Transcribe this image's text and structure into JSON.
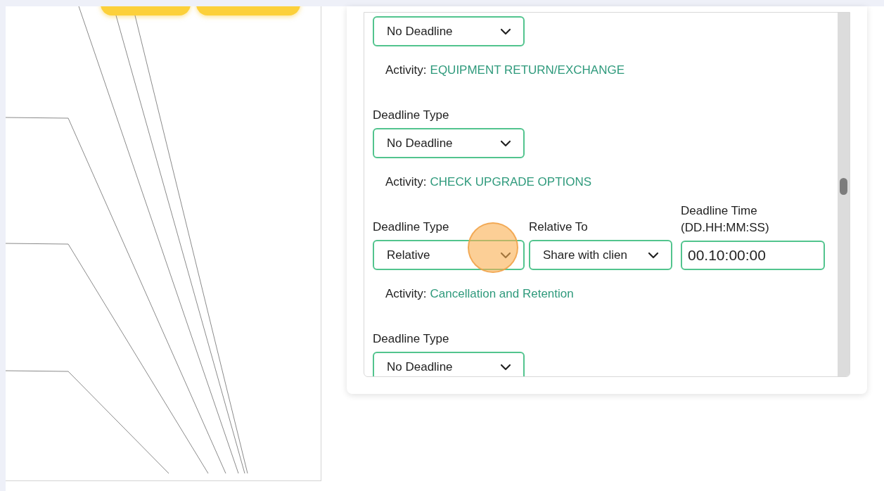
{
  "sections": [
    {
      "select": "No Deadline",
      "activity_label": "Activity:",
      "activity": "EQUIPMENT RETURN/EXCHANGE"
    },
    {
      "label": "Deadline Type",
      "select": "No Deadline",
      "activity_label": "Activity:",
      "activity": "CHECK UPGRADE OPTIONS"
    },
    {
      "label": "Deadline Type",
      "select": "Relative",
      "relative_to": {
        "label": "Relative To",
        "value": "Share with clien"
      },
      "deadline_time": {
        "label": "Deadline Time (DD.HH:MM:SS)",
        "value": "00.10:00:00"
      },
      "activity_label": "Activity:",
      "activity": "Cancellation and Retention"
    },
    {
      "label": "Deadline Type",
      "select": "No Deadline"
    }
  ]
}
